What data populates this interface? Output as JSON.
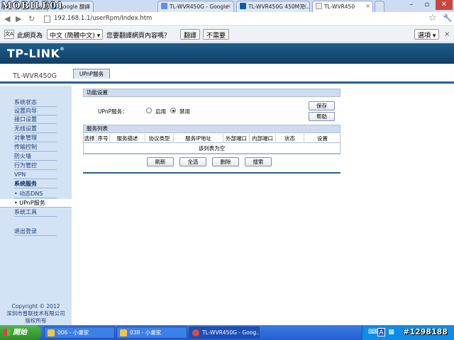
{
  "watermark": {
    "brand": "MOBILE01",
    "id": "#1298188"
  },
  "browser": {
    "tabs": [
      {
        "label": "Google 翻譯",
        "active": false
      },
      {
        "label": "TL-WVR450G - Google",
        "active": false
      },
      {
        "label": "TL-WVR450G 450M无...",
        "active": false
      },
      {
        "label": "TL-WVR450",
        "active": true
      }
    ],
    "url": "192.168.1.1/userRpm/Index.htm",
    "translate_bar": {
      "prefix": "此網頁為",
      "language": "中文 (簡體中文) ▾",
      "question": "您要翻譯網頁內容嗎？",
      "translate_button": "翻譯",
      "no_button": "不需要",
      "options_button": "選項 ▾"
    }
  },
  "router": {
    "logo": "TP-LINK",
    "model": "TL-WVR450G",
    "active_tab": "UPnP服务",
    "sidebar": [
      {
        "label": "系统状态",
        "style": "normal"
      },
      {
        "label": "设置向导",
        "style": "normal"
      },
      {
        "label": "接口设置",
        "style": "normal"
      },
      {
        "label": "无线设置",
        "style": "normal"
      },
      {
        "label": "对象管理",
        "style": "normal"
      },
      {
        "label": "传输控制",
        "style": "normal"
      },
      {
        "label": "防火墙",
        "style": "normal"
      },
      {
        "label": "行为管控",
        "style": "normal"
      },
      {
        "label": "VPN",
        "style": "normal"
      },
      {
        "label": "系统服务",
        "style": "bold"
      },
      {
        "label": "• 动态DNS",
        "style": "sub"
      },
      {
        "label": "• UPnP服务",
        "style": "active"
      },
      {
        "label": "系统工具",
        "style": "normal"
      },
      {
        "label": "退出登录",
        "style": "normal"
      }
    ],
    "copyright": [
      "Copyright © 2012",
      "深圳市普联技术有限公司",
      "版权所有"
    ],
    "function_section": {
      "title": "功能设置",
      "upnp_label": "UPnP服务：",
      "enable_label": "启用",
      "disable_label": "禁用",
      "selected": "禁用",
      "save_button": "保存",
      "help_button": "帮助"
    },
    "service_list": {
      "title": "服务列表",
      "columns": [
        "选择",
        "序号",
        "服务描述",
        "协议类型",
        "服务IP地址",
        "外部端口",
        "内部端口",
        "状态",
        "设置"
      ],
      "empty_text": "该列表为空",
      "buttons": [
        "刷新",
        "全选",
        "删除",
        "搜索"
      ]
    }
  },
  "taskbar": {
    "start": "開始",
    "tasks": [
      {
        "label": "006 - 小畫家",
        "active": false
      },
      {
        "label": "038 - 小畫家",
        "active": false
      },
      {
        "label": "TL-WVR450G - Goog...",
        "active": true
      }
    ],
    "tray_lang": "A"
  }
}
